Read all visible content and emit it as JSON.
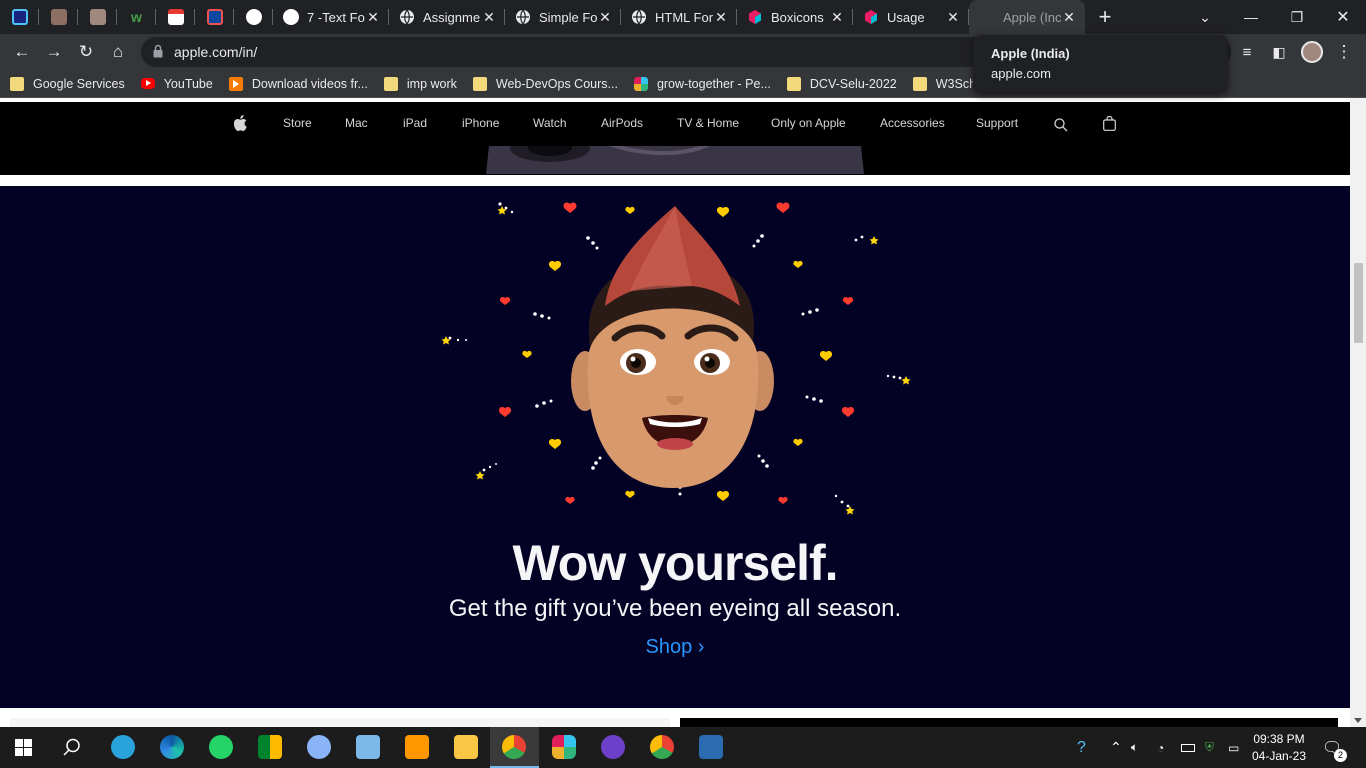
{
  "browser": {
    "pinned_tabs": [
      {
        "icon": "dark-app-icon",
        "color": "#1a237e"
      },
      {
        "icon": "bronze-tile-icon",
        "color": "#8d6e63"
      },
      {
        "icon": "bronze-tile-icon",
        "color": "#8d6e63"
      },
      {
        "icon": "w-logo-icon",
        "color": "#2e7d32"
      },
      {
        "icon": "calendar-icon",
        "color": "#e53935"
      },
      {
        "icon": "dark-app-icon",
        "color": "#1565c0"
      },
      {
        "icon": "avatar-icon",
        "color": "#ffffff"
      }
    ],
    "tabs": [
      {
        "title": "7 -Text Fo",
        "icon": "avatar-icon"
      },
      {
        "title": "Assignme",
        "icon": "globe-icon"
      },
      {
        "title": "Simple Fo",
        "icon": "globe-icon"
      },
      {
        "title": "HTML For",
        "icon": "globe-icon"
      },
      {
        "title": "Boxicons",
        "icon": "cube-icon"
      },
      {
        "title": "Usage",
        "icon": "cube-icon"
      },
      {
        "title": "Apple (Inc",
        "icon": "apple-icon",
        "active": true
      }
    ],
    "url": "apple.com/in/",
    "tooltip": {
      "title": "Apple (India)",
      "domain": "apple.com"
    },
    "bookmarks": [
      {
        "label": "Google Services",
        "icon": "folder-icon"
      },
      {
        "label": "YouTube",
        "icon": "youtube-icon"
      },
      {
        "label": "Download videos fr...",
        "icon": "download-icon"
      },
      {
        "label": "imp work",
        "icon": "folder-icon"
      },
      {
        "label": "Web-DevOps Cours...",
        "icon": "folder-icon"
      },
      {
        "label": "grow-together - Pe...",
        "icon": "slack-icon"
      },
      {
        "label": "DCV-Selu-2022",
        "icon": "folder-icon"
      },
      {
        "label": "W3Schools",
        "icon": "folder-icon"
      }
    ]
  },
  "apple_nav": {
    "items": [
      "Store",
      "Mac",
      "iPad",
      "iPhone",
      "Watch",
      "AirPods",
      "TV & Home",
      "Only on Apple",
      "Accessories",
      "Support"
    ]
  },
  "hero": {
    "title": "Wow yourself.",
    "subtitle": "Get the gift you’ve been eyeing all season.",
    "cta": "Shop ›",
    "background": "#040224",
    "cta_color": "#2997ff"
  },
  "taskbar": {
    "time": "09:38 PM",
    "date": "04-Jan-23",
    "notification_count": "2"
  }
}
